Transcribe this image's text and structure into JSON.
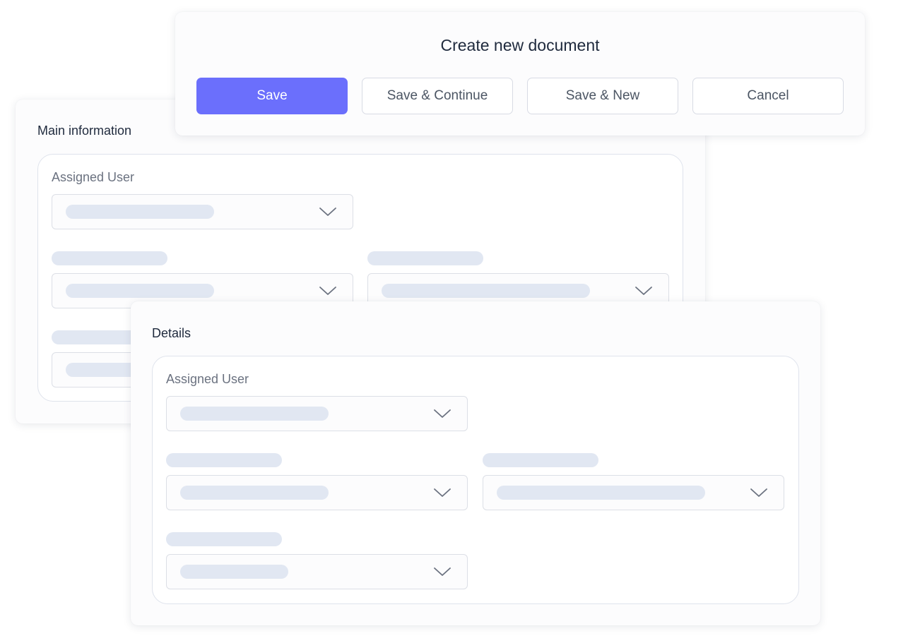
{
  "dialog": {
    "title": "Create new document",
    "buttons": {
      "save": "Save",
      "save_continue": "Save & Continue",
      "save_new": "Save & New",
      "cancel": "Cancel"
    },
    "accent_color": "#6B6FFC"
  },
  "main_panel": {
    "title": "Main information",
    "assigned_user_label": "Assigned User"
  },
  "details_panel": {
    "title": "Details",
    "assigned_user_label": "Assigned User"
  },
  "icons": {
    "dropdown": "chevron-down-icon"
  }
}
